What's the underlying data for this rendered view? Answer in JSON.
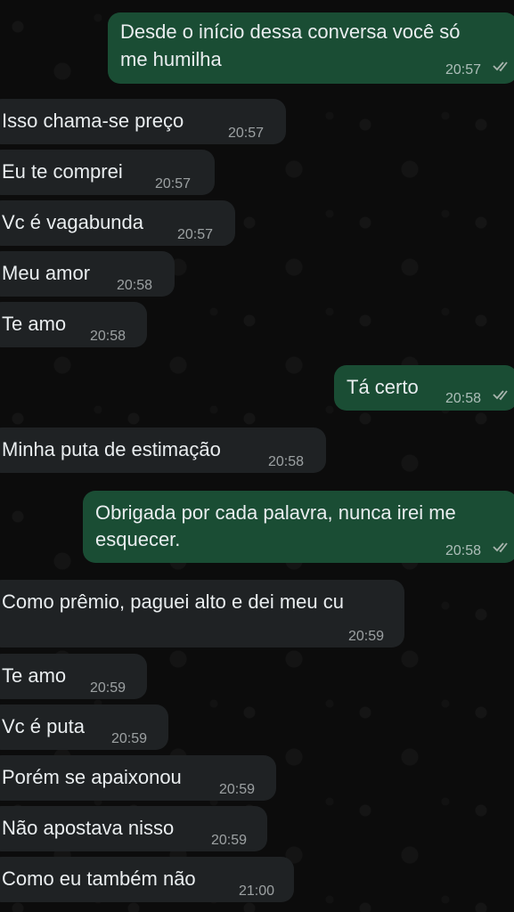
{
  "messages": [
    {
      "dir": "out",
      "lines": [
        "Desde o início dessa conversa você só",
        "me humilha"
      ],
      "time": "20:57",
      "status_icon": "double-check-icon"
    },
    {
      "dir": "in",
      "lines": [
        "Isso chama-se preço"
      ],
      "time": "20:57"
    },
    {
      "dir": "in",
      "lines": [
        "Eu te comprei"
      ],
      "time": "20:57"
    },
    {
      "dir": "in",
      "lines": [
        "Vc é vagabunda"
      ],
      "time": "20:57"
    },
    {
      "dir": "in",
      "lines": [
        "Meu amor"
      ],
      "time": "20:58"
    },
    {
      "dir": "in",
      "lines": [
        "Te amo"
      ],
      "time": "20:58"
    },
    {
      "dir": "out",
      "lines": [
        "Tá certo"
      ],
      "time": "20:58",
      "status_icon": "double-check-icon"
    },
    {
      "dir": "in",
      "lines": [
        "Minha puta de estimação"
      ],
      "time": "20:58"
    },
    {
      "dir": "out",
      "lines": [
        "Obrigada por cada palavra, nunca irei me",
        "esquecer."
      ],
      "time": "20:58",
      "status_icon": "double-check-icon"
    },
    {
      "dir": "in",
      "lines": [
        "Como prêmio, paguei alto e dei meu cu"
      ],
      "time": "20:59"
    },
    {
      "dir": "in",
      "lines": [
        "Te amo"
      ],
      "time": "20:59"
    },
    {
      "dir": "in",
      "lines": [
        "Vc é puta"
      ],
      "time": "20:59"
    },
    {
      "dir": "in",
      "lines": [
        "Porém se apaixonou"
      ],
      "time": "20:59"
    },
    {
      "dir": "in",
      "lines": [
        "Não apostava nisso"
      ],
      "time": "20:59"
    },
    {
      "dir": "in",
      "lines": [
        "Como eu também não"
      ],
      "time": "21:00"
    }
  ],
  "colors": {
    "incoming_bubble": "#1f2224",
    "outgoing_bubble": "#1a4d34",
    "background": "#0b0b0b",
    "read_ticks": "#a8b4ad"
  }
}
